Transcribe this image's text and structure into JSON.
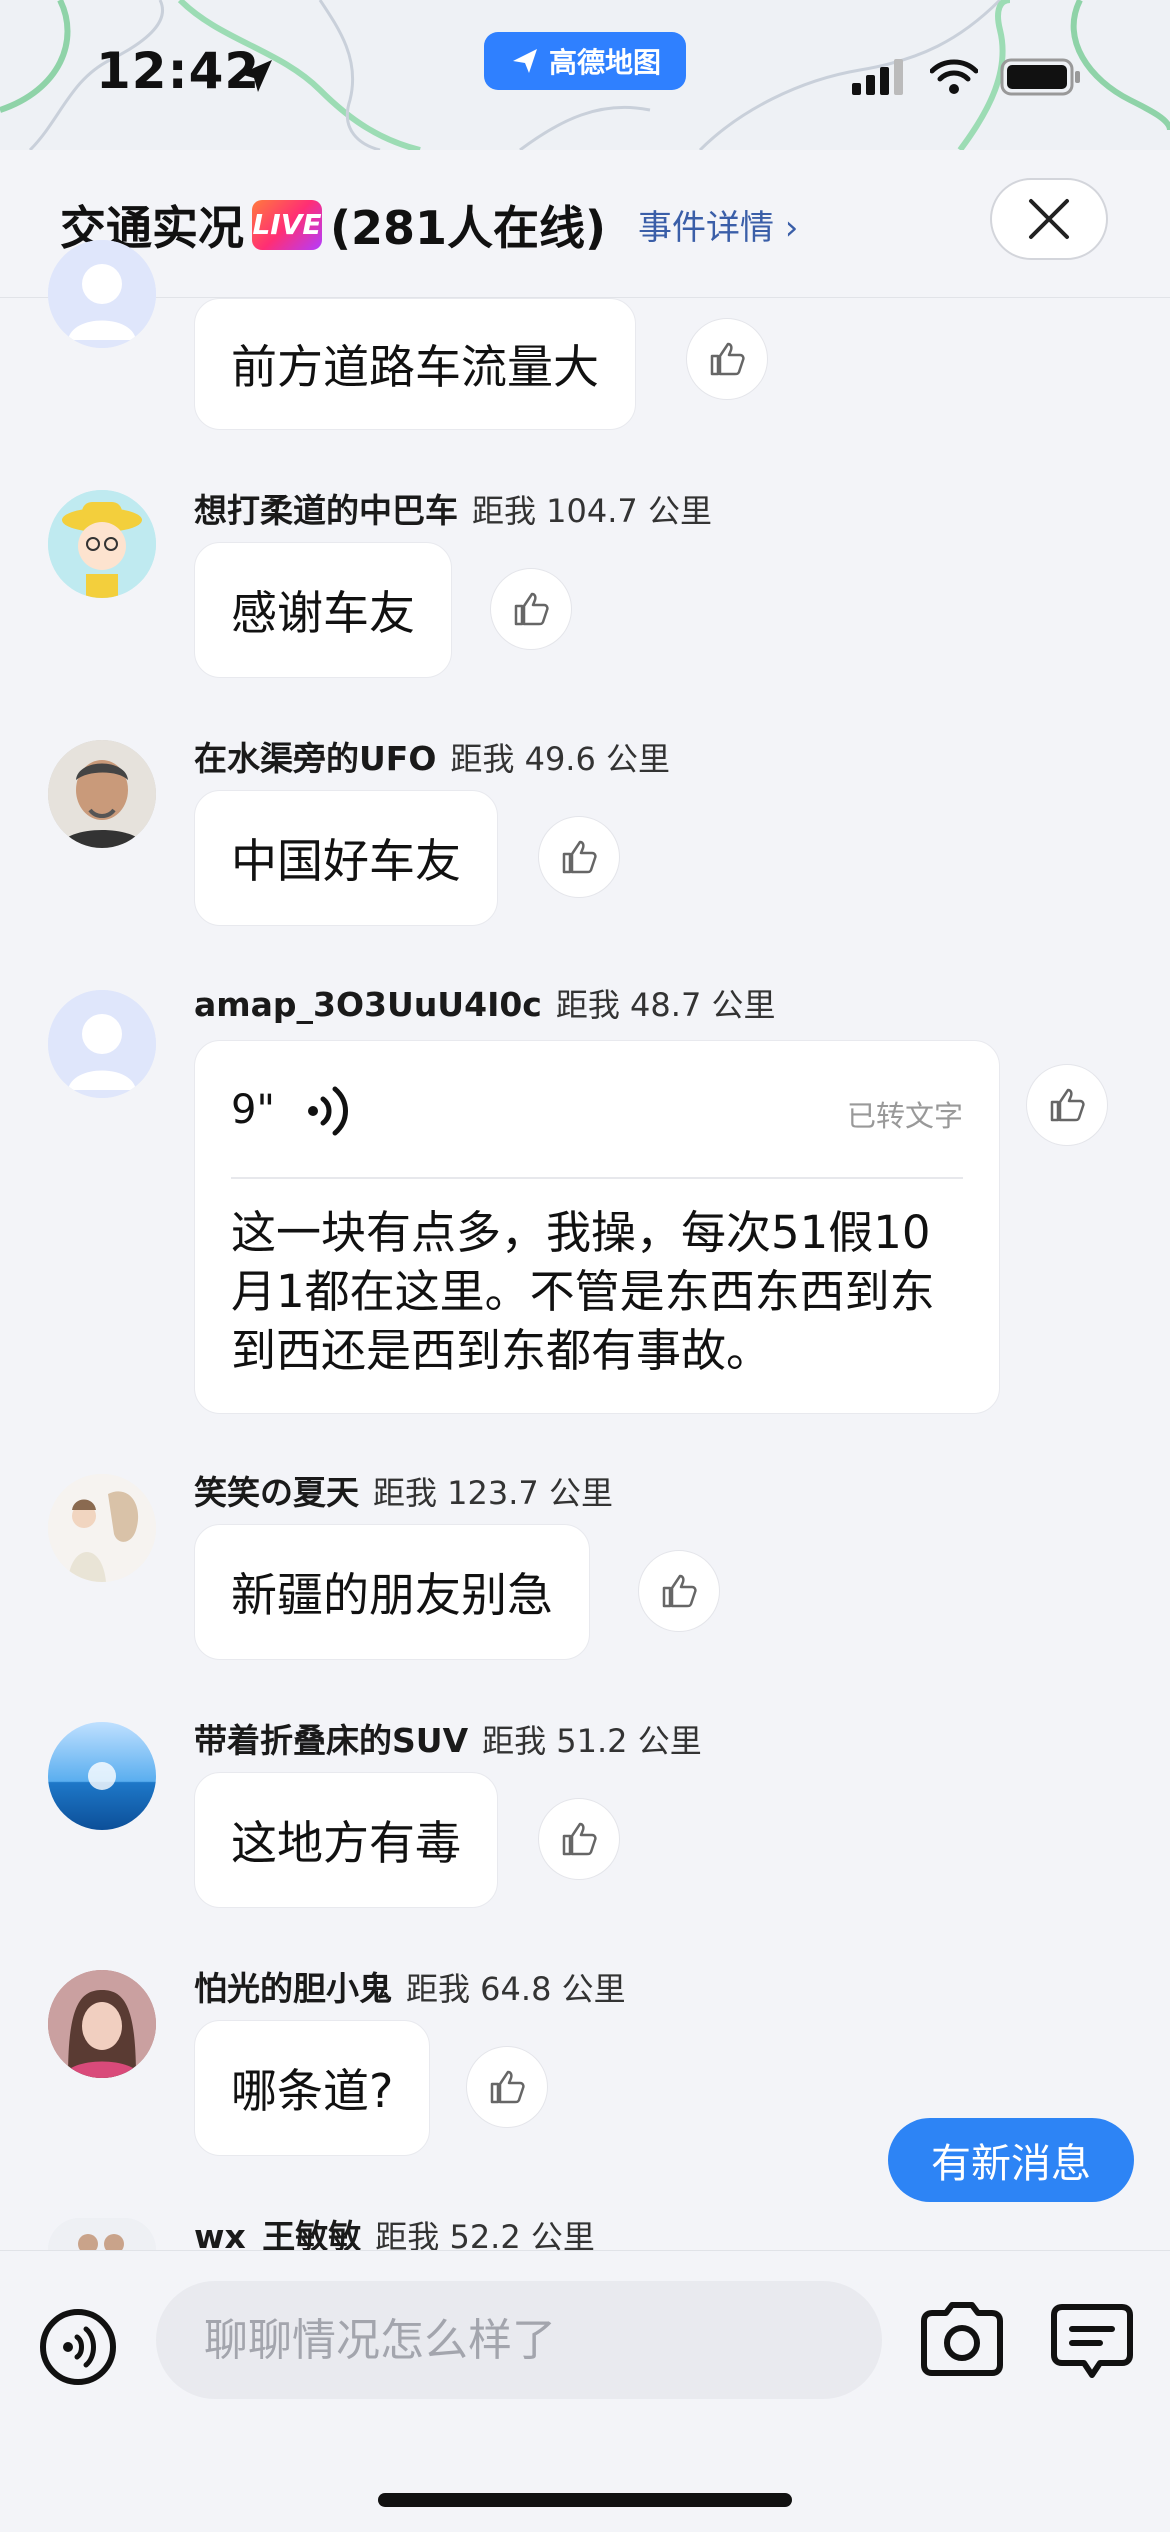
{
  "status": {
    "time": "12:42",
    "app_badge": "高德地图"
  },
  "header": {
    "title": "交通实况",
    "live": "LIVE",
    "online": "(281人在线)",
    "detail_link": "事件详情 ›"
  },
  "messages": [
    {
      "name": "",
      "distance": "",
      "text": "前方道路车流量大"
    },
    {
      "name": "想打柔道的中巴车",
      "distance": "距我 104.7 公里",
      "text": "感谢车友"
    },
    {
      "name": "在水渠旁的UFO",
      "distance": "距我 49.6 公里",
      "text": "中国好车友"
    },
    {
      "name": "amap_3O3UuU4I0c",
      "distance": "距我 48.7 公里",
      "voice_duration": "9\"",
      "voice_status": "已转文字",
      "text": "这一块有点多，我操，每次51假10月1都在这里。不管是东西东西到东到西还是西到东都有事故。"
    },
    {
      "name": "笑笑の夏天",
      "distance": "距我 123.7 公里",
      "text": "新疆的朋友别急"
    },
    {
      "name": "带着折叠床的SUV",
      "distance": "距我 51.2 公里",
      "text": "这地方有毒"
    },
    {
      "name": "怕光的胆小鬼",
      "distance": "距我 64.8 公里",
      "text": "哪条道?"
    },
    {
      "name": "wx_王敏敏",
      "distance": "距我 52.2 公里",
      "text": ""
    }
  ],
  "new_message_button": "有新消息",
  "input": {
    "placeholder": "聊聊情况怎么样了"
  },
  "colors": {
    "accent": "#2d84f5",
    "background": "#f3f4f8"
  }
}
